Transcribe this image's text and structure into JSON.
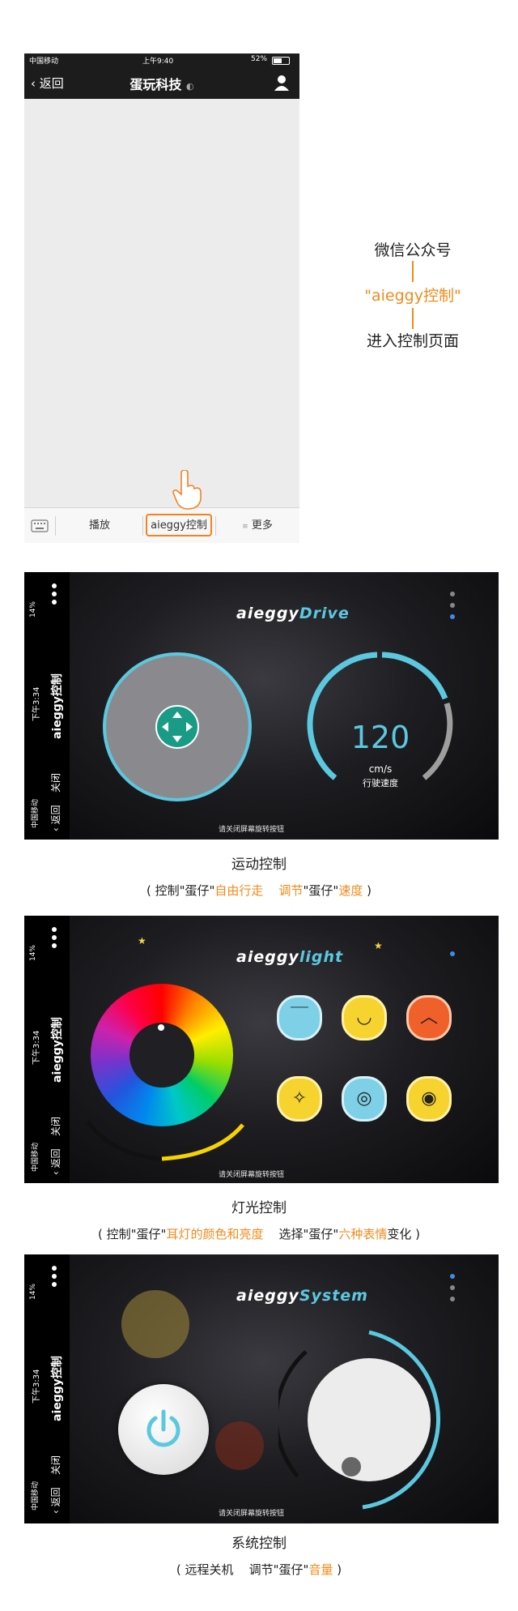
{
  "phone": {
    "status_bar": {
      "carrier": "中国移动",
      "time": "上午9:40",
      "battery": "52%"
    },
    "nav": {
      "back_label": "返回",
      "title": "蛋玩科技",
      "ear_icon": "ear-icon",
      "profile_icon": "user-icon"
    },
    "menu": {
      "keyboard_icon": "keyboard-icon",
      "items": [
        "播放",
        "aieggy控制",
        "更多"
      ]
    }
  },
  "annotation": {
    "line1": "微信公众号",
    "line2": "\"aieggy控制\"",
    "line3": "进入控制页面"
  },
  "sidebar": {
    "app_name": "aieggy控制",
    "time": "下午3:34",
    "battery": "14%",
    "carrier": "中国移动",
    "back_label": "返回",
    "close_label": "关闭"
  },
  "drive": {
    "logo_a": "aieggy",
    "logo_b": "Drive",
    "speed_value": "120",
    "speed_unit": "cm/s",
    "speed_label": "行驶速度",
    "hint": "请关闭屏幕旋转按钮",
    "caption": "运动控制",
    "sub": {
      "p1": "( 控制\"蛋仔\"",
      "h1": "自由行走",
      "p2": "调节",
      "p3": "\"蛋仔\"",
      "h2": "速度",
      "p4": " )"
    }
  },
  "light": {
    "logo_a": "aieggy",
    "logo_b": "light",
    "hint": "请关闭屏幕旋转按钮",
    "caption": "灯光控制",
    "sub": {
      "p1": "( 控制\"蛋仔\"",
      "h1": "耳灯的颜色和亮度",
      "p2": "选择\"蛋仔\"",
      "h2": "六种表情",
      "p3": "变化 )"
    }
  },
  "system": {
    "logo_a": "aieggy",
    "logo_b": "System",
    "hint": "请关闭屏幕旋转按钮",
    "caption": "系统控制",
    "sub": {
      "p1": "( 远程关机",
      "p2": "调节\"蛋仔\"",
      "h1": "音量",
      "p3": " )"
    }
  },
  "colors": {
    "orange": "#f08b1c",
    "cyan": "#5bc8e0",
    "teal": "#1a9b86",
    "highlight_border": "#f5821f"
  }
}
